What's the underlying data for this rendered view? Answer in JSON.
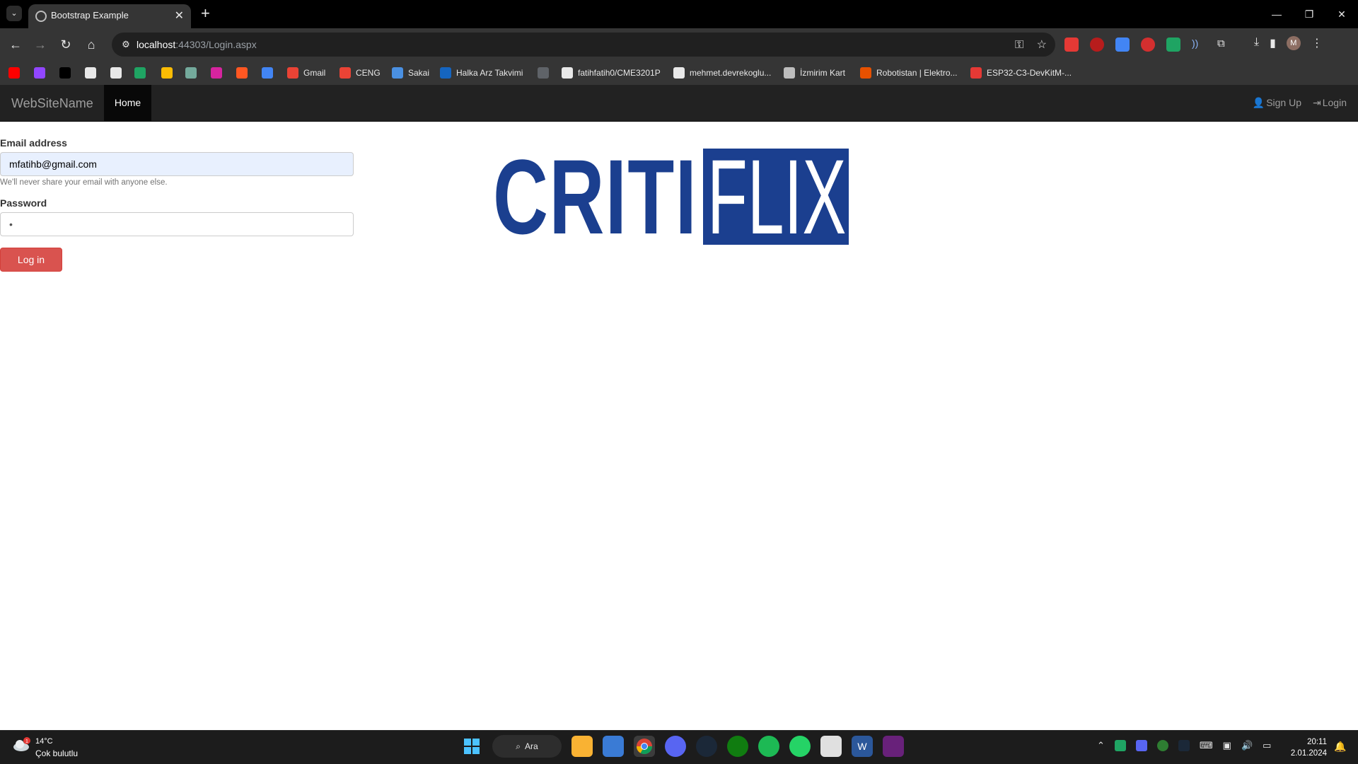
{
  "browser": {
    "tab_title": "Bootstrap Example",
    "url_host": "localhost",
    "url_path": ":44303/Login.aspx",
    "bookmarks": [
      {
        "label": "",
        "icon": "youtube-icon",
        "color": "#ff0000"
      },
      {
        "label": "",
        "icon": "twitch-icon",
        "color": "#9146ff"
      },
      {
        "label": "",
        "icon": "x-icon",
        "color": "#000000"
      },
      {
        "label": "",
        "icon": "github-icon",
        "color": "#e8e8e8"
      },
      {
        "label": "",
        "icon": "database-icon",
        "color": "#e8e8e8"
      },
      {
        "label": "",
        "icon": "google-drive-icon",
        "color": "#1fa463"
      },
      {
        "label": "",
        "icon": "pinwheel-icon",
        "color": "#fbbc04"
      },
      {
        "label": "",
        "icon": "chatgpt-icon",
        "color": "#74aa9c"
      },
      {
        "label": "",
        "icon": "microphone-icon",
        "color": "#d6249f"
      },
      {
        "label": "",
        "icon": "pe-icon",
        "color": "#ff5722"
      },
      {
        "label": "",
        "icon": "translate-icon",
        "color": "#4285f4"
      },
      {
        "label": "Gmail",
        "icon": "gmail-icon",
        "color": "#ea4335"
      },
      {
        "label": "CENG",
        "icon": "gmail-icon",
        "color": "#ea4335"
      },
      {
        "label": "Sakai",
        "icon": "sakai-icon",
        "color": "#4a90e2"
      },
      {
        "label": "Halka Arz Takvimi",
        "icon": "calendar-icon",
        "color": "#1565c0"
      },
      {
        "label": "",
        "icon": "screen-icon",
        "color": "#5f6368"
      },
      {
        "label": "fatihfatih0/CME3201P",
        "icon": "github-icon",
        "color": "#e8e8e8"
      },
      {
        "label": "mehmet.devrekoglu...",
        "icon": "globe-icon",
        "color": "#e8e8e8"
      },
      {
        "label": "İzmirim Kart",
        "icon": "card-icon",
        "color": "#bdbdbd"
      },
      {
        "label": "Robotistan | Elektro...",
        "icon": "robot-icon",
        "color": "#e65100"
      },
      {
        "label": "ESP32-C3-DevKitM-...",
        "icon": "espressif-icon",
        "color": "#e53935"
      }
    ]
  },
  "site": {
    "brand": "WebSiteName",
    "nav_home": "Home",
    "nav_signup": "Sign Up",
    "nav_login": "Login"
  },
  "form": {
    "email_label": "Email address",
    "email_value": "mfatihb@gmail.com",
    "email_help": "We'll never share your email with anyone else.",
    "password_label": "Password",
    "password_value": "•",
    "submit_label": "Log in"
  },
  "logo": {
    "part1": "CRITI",
    "part2": "FLIX",
    "color": "#1b3f8f"
  },
  "taskbar": {
    "weather_temp": "14°C",
    "weather_desc": "Çok bulutlu",
    "weather_badge": "1",
    "search_label": "Ara",
    "time": "20:11",
    "date": "2.01.2024"
  }
}
